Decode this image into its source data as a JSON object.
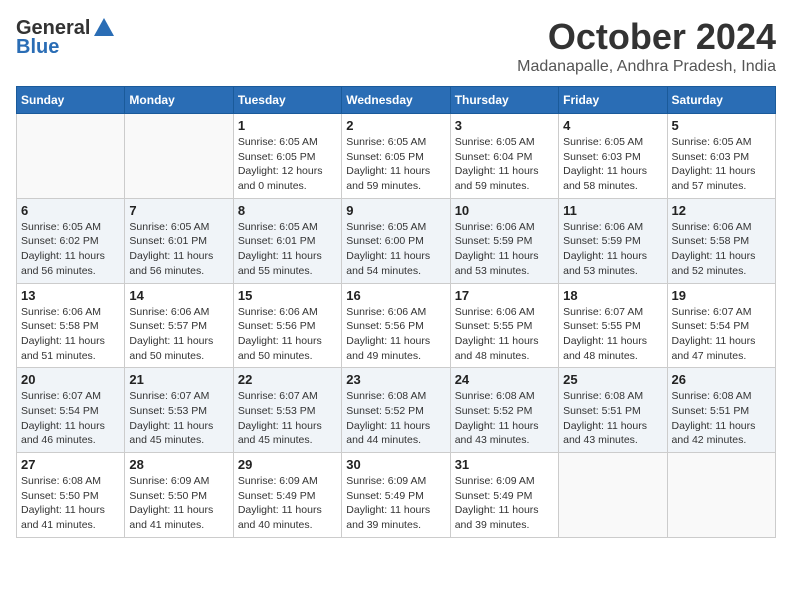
{
  "header": {
    "logo_general": "General",
    "logo_blue": "Blue",
    "month_title": "October 2024",
    "location": "Madanapalle, Andhra Pradesh, India"
  },
  "weekdays": [
    "Sunday",
    "Monday",
    "Tuesday",
    "Wednesday",
    "Thursday",
    "Friday",
    "Saturday"
  ],
  "weeks": [
    [
      {
        "day": "",
        "info": ""
      },
      {
        "day": "",
        "info": ""
      },
      {
        "day": "1",
        "info": "Sunrise: 6:05 AM\nSunset: 6:05 PM\nDaylight: 12 hours\nand 0 minutes."
      },
      {
        "day": "2",
        "info": "Sunrise: 6:05 AM\nSunset: 6:05 PM\nDaylight: 11 hours\nand 59 minutes."
      },
      {
        "day": "3",
        "info": "Sunrise: 6:05 AM\nSunset: 6:04 PM\nDaylight: 11 hours\nand 59 minutes."
      },
      {
        "day": "4",
        "info": "Sunrise: 6:05 AM\nSunset: 6:03 PM\nDaylight: 11 hours\nand 58 minutes."
      },
      {
        "day": "5",
        "info": "Sunrise: 6:05 AM\nSunset: 6:03 PM\nDaylight: 11 hours\nand 57 minutes."
      }
    ],
    [
      {
        "day": "6",
        "info": "Sunrise: 6:05 AM\nSunset: 6:02 PM\nDaylight: 11 hours\nand 56 minutes."
      },
      {
        "day": "7",
        "info": "Sunrise: 6:05 AM\nSunset: 6:01 PM\nDaylight: 11 hours\nand 56 minutes."
      },
      {
        "day": "8",
        "info": "Sunrise: 6:05 AM\nSunset: 6:01 PM\nDaylight: 11 hours\nand 55 minutes."
      },
      {
        "day": "9",
        "info": "Sunrise: 6:05 AM\nSunset: 6:00 PM\nDaylight: 11 hours\nand 54 minutes."
      },
      {
        "day": "10",
        "info": "Sunrise: 6:06 AM\nSunset: 5:59 PM\nDaylight: 11 hours\nand 53 minutes."
      },
      {
        "day": "11",
        "info": "Sunrise: 6:06 AM\nSunset: 5:59 PM\nDaylight: 11 hours\nand 53 minutes."
      },
      {
        "day": "12",
        "info": "Sunrise: 6:06 AM\nSunset: 5:58 PM\nDaylight: 11 hours\nand 52 minutes."
      }
    ],
    [
      {
        "day": "13",
        "info": "Sunrise: 6:06 AM\nSunset: 5:58 PM\nDaylight: 11 hours\nand 51 minutes."
      },
      {
        "day": "14",
        "info": "Sunrise: 6:06 AM\nSunset: 5:57 PM\nDaylight: 11 hours\nand 50 minutes."
      },
      {
        "day": "15",
        "info": "Sunrise: 6:06 AM\nSunset: 5:56 PM\nDaylight: 11 hours\nand 50 minutes."
      },
      {
        "day": "16",
        "info": "Sunrise: 6:06 AM\nSunset: 5:56 PM\nDaylight: 11 hours\nand 49 minutes."
      },
      {
        "day": "17",
        "info": "Sunrise: 6:06 AM\nSunset: 5:55 PM\nDaylight: 11 hours\nand 48 minutes."
      },
      {
        "day": "18",
        "info": "Sunrise: 6:07 AM\nSunset: 5:55 PM\nDaylight: 11 hours\nand 48 minutes."
      },
      {
        "day": "19",
        "info": "Sunrise: 6:07 AM\nSunset: 5:54 PM\nDaylight: 11 hours\nand 47 minutes."
      }
    ],
    [
      {
        "day": "20",
        "info": "Sunrise: 6:07 AM\nSunset: 5:54 PM\nDaylight: 11 hours\nand 46 minutes."
      },
      {
        "day": "21",
        "info": "Sunrise: 6:07 AM\nSunset: 5:53 PM\nDaylight: 11 hours\nand 45 minutes."
      },
      {
        "day": "22",
        "info": "Sunrise: 6:07 AM\nSunset: 5:53 PM\nDaylight: 11 hours\nand 45 minutes."
      },
      {
        "day": "23",
        "info": "Sunrise: 6:08 AM\nSunset: 5:52 PM\nDaylight: 11 hours\nand 44 minutes."
      },
      {
        "day": "24",
        "info": "Sunrise: 6:08 AM\nSunset: 5:52 PM\nDaylight: 11 hours\nand 43 minutes."
      },
      {
        "day": "25",
        "info": "Sunrise: 6:08 AM\nSunset: 5:51 PM\nDaylight: 11 hours\nand 43 minutes."
      },
      {
        "day": "26",
        "info": "Sunrise: 6:08 AM\nSunset: 5:51 PM\nDaylight: 11 hours\nand 42 minutes."
      }
    ],
    [
      {
        "day": "27",
        "info": "Sunrise: 6:08 AM\nSunset: 5:50 PM\nDaylight: 11 hours\nand 41 minutes."
      },
      {
        "day": "28",
        "info": "Sunrise: 6:09 AM\nSunset: 5:50 PM\nDaylight: 11 hours\nand 41 minutes."
      },
      {
        "day": "29",
        "info": "Sunrise: 6:09 AM\nSunset: 5:49 PM\nDaylight: 11 hours\nand 40 minutes."
      },
      {
        "day": "30",
        "info": "Sunrise: 6:09 AM\nSunset: 5:49 PM\nDaylight: 11 hours\nand 39 minutes."
      },
      {
        "day": "31",
        "info": "Sunrise: 6:09 AM\nSunset: 5:49 PM\nDaylight: 11 hours\nand 39 minutes."
      },
      {
        "day": "",
        "info": ""
      },
      {
        "day": "",
        "info": ""
      }
    ]
  ]
}
